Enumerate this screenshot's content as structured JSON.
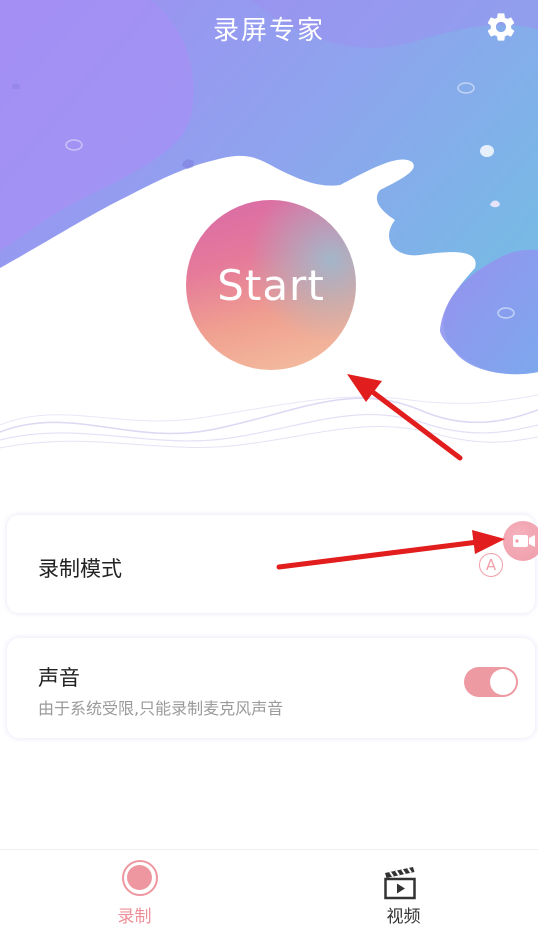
{
  "header": {
    "title": "录屏专家",
    "settings_icon": "gear-icon"
  },
  "start": {
    "label": "Start"
  },
  "mode_card": {
    "title": "录制模式",
    "badge": "A",
    "float_icon": "camera-icon"
  },
  "sound_card": {
    "title": "声音",
    "subtitle": "由于系统受限,只能录制麦克风声音",
    "toggle_on": true
  },
  "tabs": [
    {
      "label": "录制",
      "icon": "record-icon",
      "active": true
    },
    {
      "label": "视频",
      "icon": "clapperboard-icon",
      "active": false
    }
  ],
  "colors": {
    "accent": "#ee8f98",
    "hero_purple": "#9b8cf0",
    "hero_blue": "#7fb6ea",
    "annotation_arrow": "#e21d1d"
  }
}
